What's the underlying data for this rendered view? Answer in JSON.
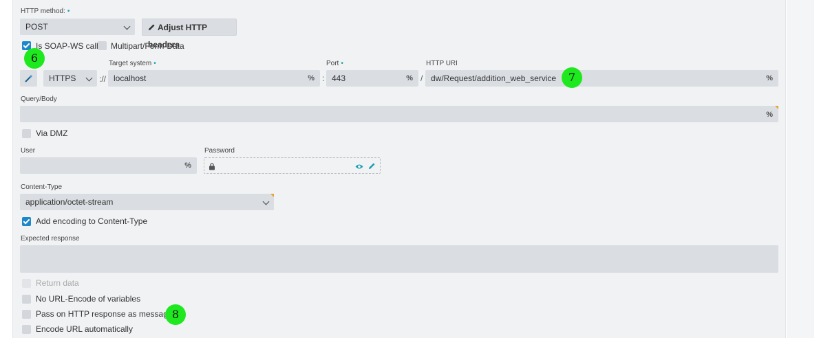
{
  "http_method": {
    "label": "HTTP method:",
    "value": "POST"
  },
  "adjust_headers_label": "Adjust HTTP headers",
  "soap": {
    "label": "Is SOAP-WS call",
    "checked": true
  },
  "multipart": {
    "label": "Multipart/Form-Data",
    "checked": false
  },
  "protocol": {
    "value": "HTTPS"
  },
  "protocol_sep": "://",
  "target_system": {
    "label": "Target system",
    "value": "localhost"
  },
  "port_sep": ":",
  "port": {
    "label": "Port",
    "value": "443"
  },
  "uri_sep": "/",
  "http_uri": {
    "label": "HTTP URI",
    "value": "dw/Request/addition_web_service"
  },
  "variable_icon_glyph": "%",
  "required_marker": "•",
  "query_body": {
    "label": "Query/Body",
    "value": ""
  },
  "via_dmz": {
    "label": "Via DMZ",
    "checked": false
  },
  "user": {
    "label": "User",
    "value": ""
  },
  "password": {
    "label": "Password",
    "value": ""
  },
  "content_type": {
    "label": "Content-Type",
    "value": "application/octet-stream"
  },
  "add_encoding": {
    "label": "Add encoding to Content-Type",
    "checked": true
  },
  "expected_response": {
    "label": "Expected response",
    "value": ""
  },
  "options": [
    {
      "label": "Return data",
      "checked": false,
      "disabled": true
    },
    {
      "label": "No URL-Encode of variables",
      "checked": false,
      "disabled": false
    },
    {
      "label": "Pass on HTTP response as message",
      "checked": false,
      "disabled": false
    },
    {
      "label": "Encode URL automatically",
      "checked": false,
      "disabled": false
    }
  ],
  "markers": {
    "m6": "6",
    "m7": "7",
    "m8": "8"
  },
  "icons": {
    "wand": "magic-wand-icon",
    "pencil": "pencil-icon",
    "lock": "lock-icon",
    "eye": "eye-icon",
    "chevron": "chevron-down-icon",
    "variable": "variable-icon"
  },
  "colors": {
    "accent": "#1e87c8",
    "marker": "#1ee81e",
    "required": "#1a9fb3",
    "field": "#dadde2"
  }
}
